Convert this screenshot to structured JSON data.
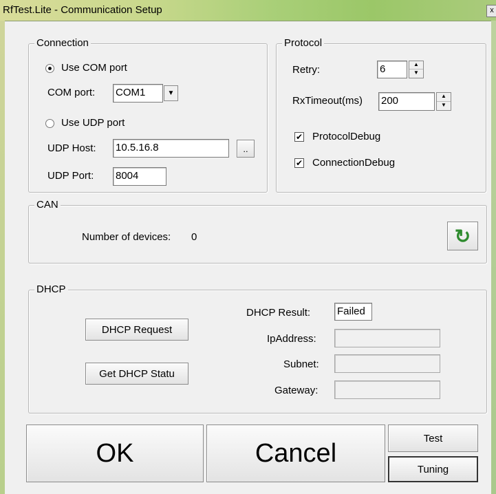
{
  "window": {
    "title": "RfTest.Lite - Communication Setup",
    "close_glyph": "x"
  },
  "connection": {
    "legend": "Connection",
    "use_com_label": "Use COM port",
    "com_port_label": "COM port:",
    "com_port_value": "COM1",
    "combo_arrow": "▼",
    "use_udp_label": "Use UDP port",
    "udp_host_label": "UDP Host:",
    "udp_host_value": "10.5.16.8",
    "browse_label": "..",
    "udp_port_label": "UDP Port:",
    "udp_port_value": "8004",
    "selected": "com"
  },
  "protocol": {
    "legend": "Protocol",
    "retry_label": "Retry:",
    "retry_value": "6",
    "rx_timeout_label": "RxTimeout(ms)",
    "rx_timeout_value": "200",
    "protocol_debug_label": "ProtocolDebug",
    "protocol_debug_checked": true,
    "connection_debug_label": "ConnectionDebug",
    "connection_debug_checked": true,
    "check_glyph": "✔"
  },
  "can": {
    "legend": "CAN",
    "devices_label": "Number of devices:",
    "devices_value": "0",
    "refresh_icon": "refresh-icon",
    "refresh_glyph": "↻",
    "refresh_color": "#2e8b2e"
  },
  "dhcp": {
    "legend": "DHCP",
    "request_button": "DHCP Request",
    "status_button": "Get DHCP Statu",
    "result_label": "DHCP Result:",
    "result_value": "Failed",
    "ip_label": "IpAddress:",
    "ip_value": "",
    "subnet_label": "Subnet:",
    "subnet_value": "",
    "gateway_label": "Gateway:",
    "gateway_value": ""
  },
  "footer": {
    "ok_label": "OK",
    "cancel_label": "Cancel",
    "test_label": "Test",
    "tuning_label": "Tuning"
  },
  "spinner": {
    "up": "▲",
    "down": "▼"
  }
}
